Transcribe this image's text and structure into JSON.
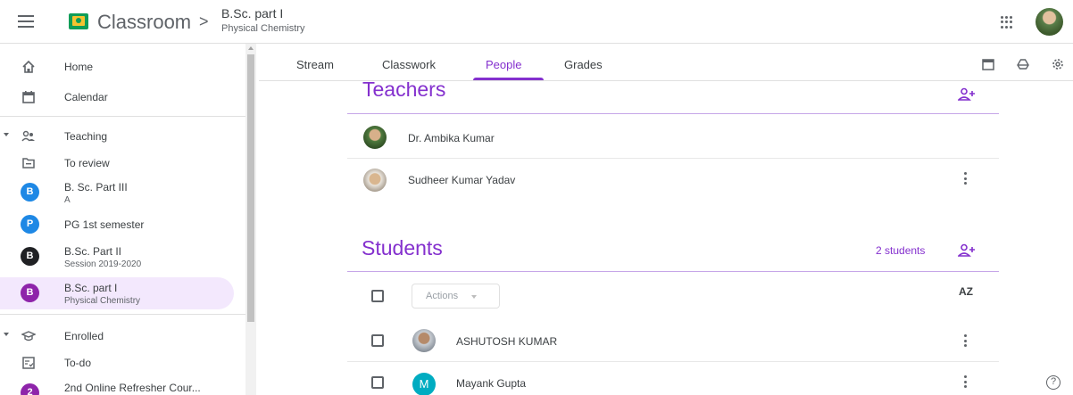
{
  "header": {
    "app_title": "Classroom",
    "crumb_separator": ">",
    "class_title": "B.Sc. part I",
    "class_subtitle": "Physical Chemistry"
  },
  "sidebar": {
    "items": [
      {
        "label": "Home",
        "icon": "home-icon"
      },
      {
        "label": "Calendar",
        "icon": "calendar-icon"
      },
      {
        "label": "Teaching",
        "icon": "teaching-icon"
      },
      {
        "label": "To review",
        "icon": "review-icon"
      },
      {
        "label": "B. Sc. Part III",
        "sub": "A",
        "letter": "B",
        "color": "#1e88e5"
      },
      {
        "label": "PG 1st semester",
        "letter": "P",
        "color": "#1e88e5"
      },
      {
        "label": "B.Sc. Part II",
        "sub": "Session 2019-2020",
        "letter": "B",
        "color": "#202124"
      },
      {
        "label": "B.Sc. part I",
        "sub": "Physical Chemistry",
        "letter": "B",
        "color": "#8e24aa"
      },
      {
        "label": "Enrolled",
        "icon": "enrolled-icon"
      },
      {
        "label": "To-do",
        "icon": "todo-icon"
      },
      {
        "label": "2nd Online Refresher Cour...",
        "letter": "2",
        "color": "#8e24aa"
      }
    ]
  },
  "tabs": [
    {
      "label": "Stream"
    },
    {
      "label": "Classwork"
    },
    {
      "label": "People",
      "active": true
    },
    {
      "label": "Grades"
    }
  ],
  "teachers": {
    "title": "Teachers",
    "people": [
      {
        "name": "Dr. Ambika Kumar"
      },
      {
        "name": "Sudheer Kumar Yadav"
      }
    ]
  },
  "students": {
    "title": "Students",
    "count_label": "2 students",
    "actions_label": "Actions",
    "sort_label": "AZ",
    "people": [
      {
        "name": "ASHUTOSH KUMAR"
      },
      {
        "name": "Mayank Gupta",
        "letter": "M",
        "color": "#00acc1"
      }
    ]
  },
  "colors": {
    "accent": "#8430ce",
    "selected_bg": "#f3e8fd"
  }
}
